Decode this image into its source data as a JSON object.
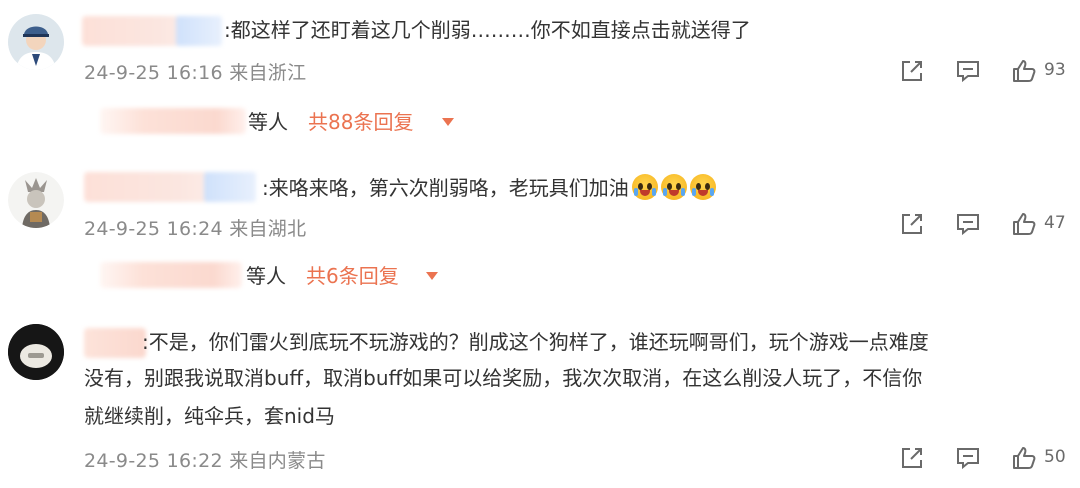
{
  "comments": [
    {
      "text_lines": [
        ":都这样了还盯着这几个削弱………你不如直接点击就送得了"
      ],
      "meta": "24-9-25 16:16 来自浙江",
      "likes": "93",
      "reply_people": "等人",
      "reply_count": "共88条回复"
    },
    {
      "text_lines": [
        ":来咯来咯，第六次削弱咯，老玩具们加油"
      ],
      "emoji": [
        "crying-face",
        "crying-face",
        "crying-face"
      ],
      "meta": "24-9-25 16:24 来自湖北",
      "likes": "47",
      "reply_people": "等人",
      "reply_count": "共6条回复"
    },
    {
      "text_lines": [
        ":不是，你们雷火到底玩不玩游戏的？削成这个狗样了，谁还玩啊哥们，玩个游戏一点难度",
        "没有，别跟我说取消buff，取消buff如果可以给奖励，我次次取消，在这么削没人玩了，不信你",
        "就继续削，纯伞兵，套nid马"
      ],
      "meta": "24-9-25 16:22 来自内蒙古",
      "likes": "50"
    }
  ],
  "icons": {
    "share": "share-icon",
    "comment": "comment-icon",
    "like": "thumbs-up-icon"
  },
  "colors": {
    "reply_accent": "#eb7350",
    "meta_text": "#8a8a8a",
    "icon_gray": "#6a6a6a"
  }
}
